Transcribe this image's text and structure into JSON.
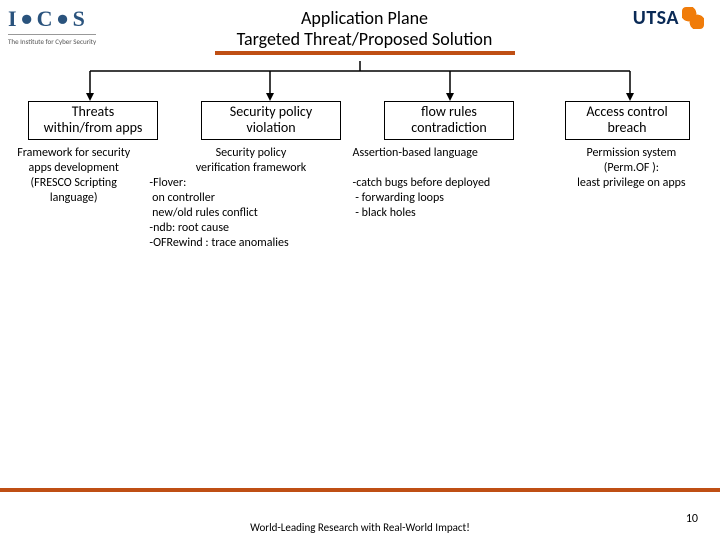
{
  "logos": {
    "ics_letters": [
      "I",
      "C",
      "S"
    ],
    "ics_sub": "The Institute for Cyber Security",
    "utsa": "UTSA"
  },
  "title": {
    "line1": "Application Plane",
    "line2": "Targeted Threat/Proposed Solution"
  },
  "columns": [
    {
      "box_l1": "Threats",
      "box_l2": "within/from apps"
    },
    {
      "box_l1": "Security policy",
      "box_l2": "violation"
    },
    {
      "box_l1": "flow rules",
      "box_l2": "contradiction"
    },
    {
      "box_l1": "Access control",
      "box_l2": "breach"
    }
  ],
  "desc": {
    "c1_l1": "Framework for security",
    "c1_l2": "apps development",
    "c1_l3": "(FRESCO Scripting",
    "c1_l4": "language)",
    "c2_l1": "Security policy",
    "c2_l2": "verification framework",
    "c2_l3": "-Flover:",
    "c2_l4": " on controller",
    "c2_l5": " new/old rules conflict",
    "c2_l6": "-ndb: root cause",
    "c2_l7": "-OFRewind : trace anomalies",
    "c3_l1": "Assertion-based language",
    "c3_l2": " ",
    "c3_l3": "-catch bugs before deployed",
    "c3_l4": " - forwarding loops",
    "c3_l5": " - black holes",
    "c4_l1": "Permission system",
    "c4_l2": "(Perm.OF ):",
    "c4_l3": "least privilege on apps"
  },
  "footer": {
    "text": "World-Leading Research with Real-World Impact!",
    "page": "10"
  }
}
